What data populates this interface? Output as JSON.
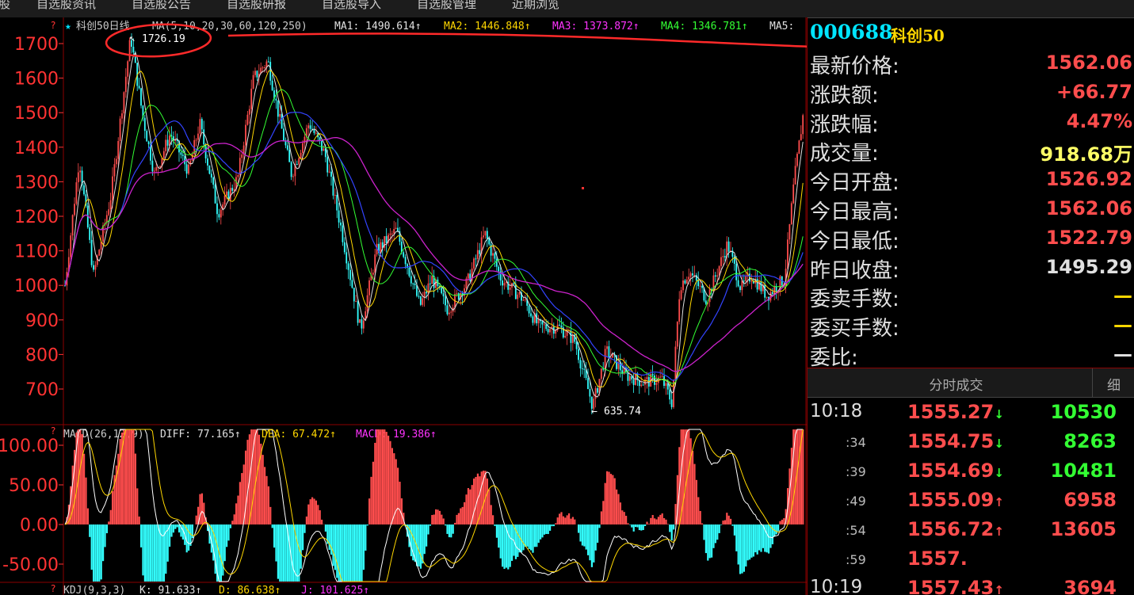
{
  "tabs": [
    "股",
    "自选股资讯",
    "自选股公告",
    "自选股研报",
    "自选股导入",
    "自选股管理",
    "近期浏览"
  ],
  "main": {
    "legend_prefix": "科创50日线",
    "ma_params": "MA(5,10,20,30,60,120,250)",
    "ma": [
      {
        "label": "MA1: 1490.614↑",
        "color": "#e0e0e0"
      },
      {
        "label": "MA2: 1446.848↑",
        "color": "#ffd700"
      },
      {
        "label": "MA3: 1373.872↑",
        "color": "#ff33ff"
      },
      {
        "label": "MA4: 1346.781↑",
        "color": "#33ff33"
      },
      {
        "label": "MA5:",
        "color": "#e0e0e0"
      }
    ],
    "high_label": "1726.19",
    "low_label": "635.74",
    "y_ticks": [
      "1700",
      "1600",
      "1500",
      "1400",
      "1300",
      "1200",
      "1100",
      "1000",
      "900",
      "800",
      "700"
    ]
  },
  "macd": {
    "legend": {
      "params": "MACD(26,12,9)",
      "diff": "DIFF: 77.165↑",
      "dea": "DEA: 67.472↑",
      "macd": "MACD: 19.386↑"
    },
    "y_ticks": [
      "100.00",
      "50.00",
      "0.00",
      "-50.00"
    ]
  },
  "kdj": {
    "legend": {
      "params": "KDJ(9,3,3)",
      "k": "K: 91.633↑",
      "d": "D: 86.638↑",
      "j": "J: 101.625↑"
    }
  },
  "quote": {
    "code": "000688",
    "name": "科创50",
    "rows": [
      {
        "label": "最新价格:",
        "value": "1562.06",
        "color": "#ff4d4d"
      },
      {
        "label": "涨跌额:",
        "value": "+66.77",
        "color": "#ff4d4d"
      },
      {
        "label": "涨跌幅:",
        "value": "4.47%",
        "color": "#ff4d4d"
      },
      {
        "label": "成交量:",
        "value": "918.68万",
        "color": "#ffff66"
      },
      {
        "label": "今日开盘:",
        "value": "1526.92",
        "color": "#ff4d4d"
      },
      {
        "label": "今日最高:",
        "value": "1562.06",
        "color": "#ff4d4d"
      },
      {
        "label": "今日最低:",
        "value": "1522.79",
        "color": "#ff4d4d"
      },
      {
        "label": "昨日收盘:",
        "value": "1495.29",
        "color": "#e0e0e0"
      },
      {
        "label": "委卖手数:",
        "value": "—",
        "color": "#ffd700"
      },
      {
        "label": "委买手数:",
        "value": "—",
        "color": "#ffd700"
      },
      {
        "label": "委比:",
        "value": "—",
        "color": "#e0e0e0"
      }
    ]
  },
  "trades": {
    "header": "分时成交",
    "detail_button": "细",
    "rows": [
      {
        "time": "10:18",
        "price": "1555.27",
        "arrow": "↓",
        "arrow_color": "#33ff33",
        "volume": "10530",
        "volume_color": "#33ff33"
      },
      {
        "time": ":34",
        "price": "1554.75",
        "arrow": "↓",
        "arrow_color": "#33ff33",
        "volume": "8263",
        "volume_color": "#33ff33"
      },
      {
        "time": ":39",
        "price": "1554.69",
        "arrow": "↓",
        "arrow_color": "#33ff33",
        "volume": "10481",
        "volume_color": "#33ff33"
      },
      {
        "time": ":49",
        "price": "1555.09",
        "arrow": "↑",
        "arrow_color": "#ff4d4d",
        "volume": "6958",
        "volume_color": "#ff4d4d"
      },
      {
        "time": ":54",
        "price": "1556.72",
        "arrow": "↑",
        "arrow_color": "#ff4d4d",
        "volume": "13605",
        "volume_color": "#ff4d4d"
      },
      {
        "time": ":59",
        "price": "1557.",
        "arrow": "",
        "arrow_color": "#ff4d4d",
        "volume": "",
        "volume_color": "#ff4d4d"
      },
      {
        "time": "10:19",
        "price": "1557.43",
        "arrow": "↑",
        "arrow_color": "#ff4d4d",
        "volume": "3694",
        "volume_color": "#ff4d4d"
      }
    ]
  },
  "colors": {
    "up": "#ff4d4d",
    "down": "#33ffff",
    "axis_red": "#ff3333",
    "annotation": "#ff2a2a"
  }
}
